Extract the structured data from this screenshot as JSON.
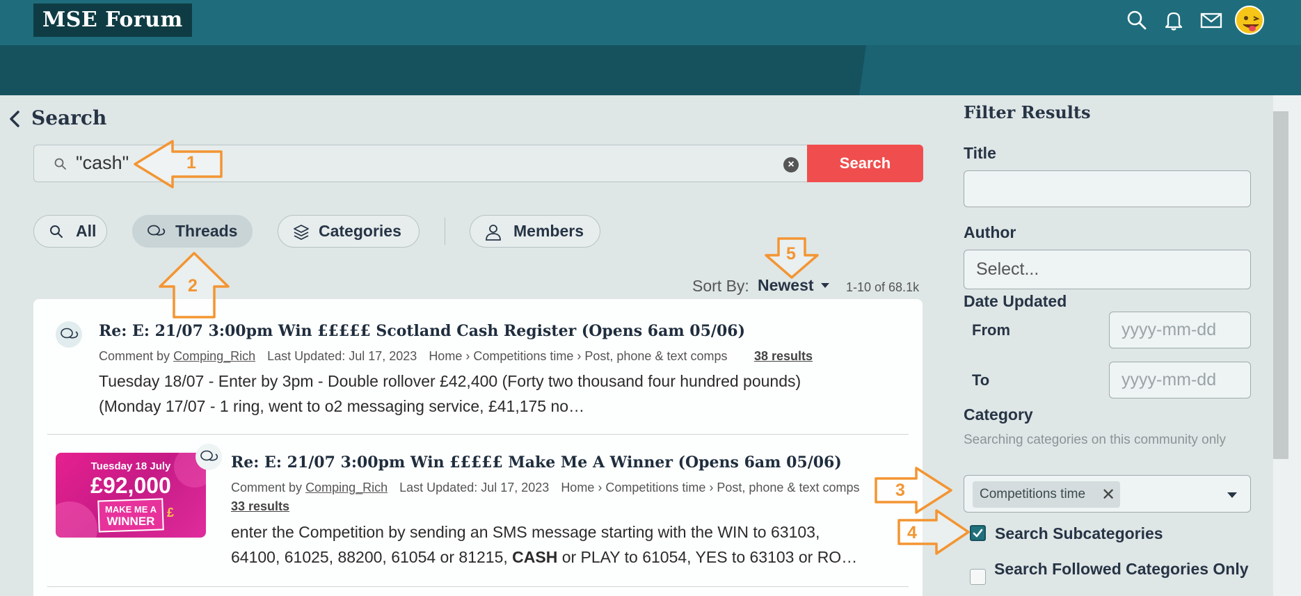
{
  "header": {
    "logo": "MSE Forum",
    "icons": [
      "search-icon",
      "bell-icon",
      "mail-icon",
      "avatar"
    ]
  },
  "page": {
    "back_icon": "chevron-left-icon",
    "title": "Search"
  },
  "search": {
    "query": "\"cash\"",
    "button_label": "Search"
  },
  "tabs": [
    {
      "label": "All",
      "icon": "search-icon",
      "active": false
    },
    {
      "label": "Threads",
      "icon": "discussion-icon",
      "active": true
    },
    {
      "label": "Categories",
      "icon": "layers-icon",
      "active": false
    },
    {
      "label": "Members",
      "icon": "user-icon",
      "active": false
    }
  ],
  "sort": {
    "label": "Sort By:",
    "value": "Newest",
    "count": "1-10 of 68.1k"
  },
  "results": [
    {
      "title": "Re: E: 21/07 3:00pm Win £££££ Scotland Cash Register (Opens 6am 05/06)",
      "comment_by_label": "Comment by",
      "author": "Comping_Rich",
      "updated": "Last Updated: Jul 17, 2023",
      "breadcrumb": "Home › Competitions time › Post, phone & text comps",
      "results_link": "38 results",
      "snippet_line1": "Tuesday 18/07 - Enter by 3pm - Double rollover £42,400 (Forty two thousand four hundred pounds)",
      "snippet_line2": "(Monday 17/07 - 1 ring, went to o2 messaging service, £41,175 no…"
    },
    {
      "title": "Re: E: 21/07 3:00pm Win £££££ Make Me A Winner (Opens 6am 05/06)",
      "comment_by_label": "Comment by",
      "author": "Comping_Rich",
      "updated": "Last Updated: Jul 17, 2023",
      "breadcrumb": "Home › Competitions time › Post, phone & text comps",
      "results_link": "33 results",
      "snippet_line1": "enter the Competition by sending an SMS message starting with the WIN to 63103,",
      "snippet_line2_pre": "64100, 61025, 88200, 61054 or 81215, ",
      "snippet_line2_bold": "CASH",
      "snippet_line2_post": " or PLAY to 61054, YES to 63103 or RO…",
      "thumb": {
        "line1": "Tuesday 18 July",
        "line2": "£92,000",
        "line3": "MAKE ME A",
        "line4": "WINNER"
      }
    }
  ],
  "filter": {
    "title": "Filter Results",
    "title_field_label": "Title",
    "author_label": "Author",
    "author_placeholder": "Select...",
    "date_label": "Date Updated",
    "from_label": "From",
    "to_label": "To",
    "date_placeholder": "yyyy-mm-dd",
    "category_label": "Category",
    "category_help": "Searching categories on this community only",
    "category_chip": "Competitions time",
    "search_subcategories": "Search Subcategories",
    "search_subcategories_checked": true,
    "followed_only": "Search Followed Categories Only",
    "followed_only_checked": false
  },
  "annotations": [
    "1",
    "2",
    "3",
    "4",
    "5"
  ],
  "colors": {
    "header": "#1f6d7c",
    "band": "#16525e",
    "search_button": "#f04e4e",
    "annotation": "#f39532"
  }
}
